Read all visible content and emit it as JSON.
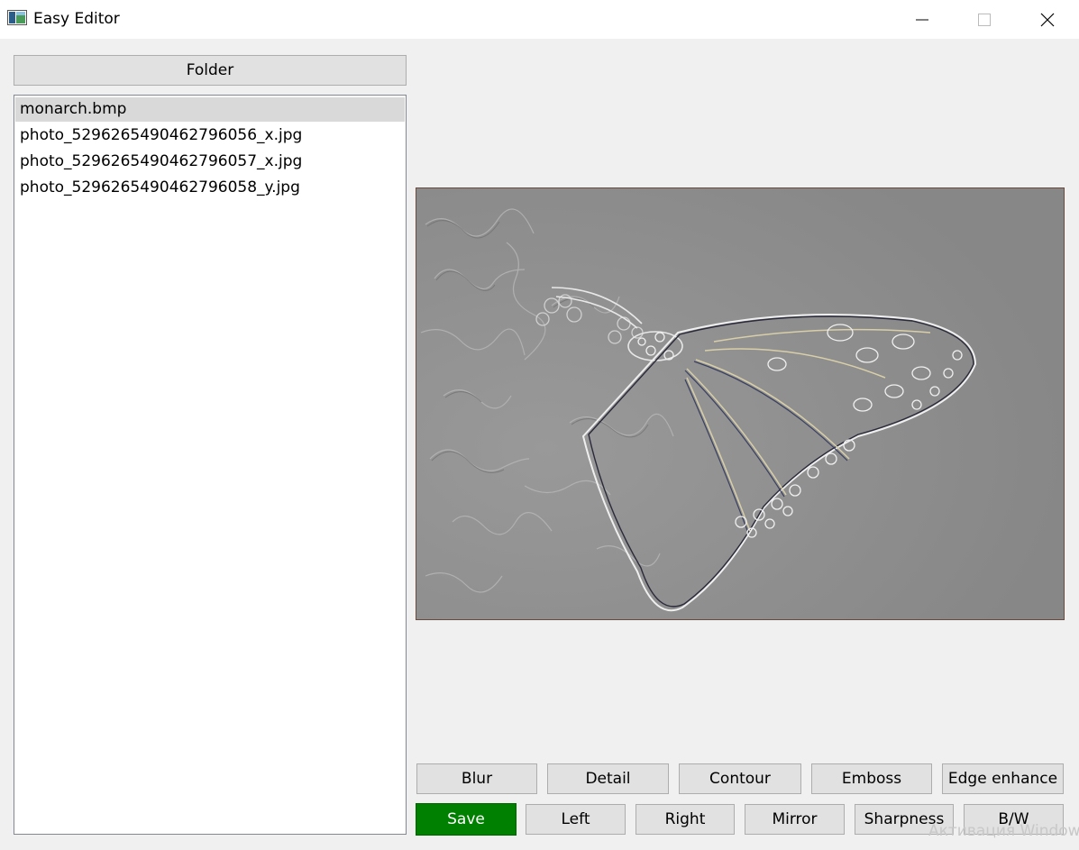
{
  "window": {
    "title": "Easy Editor",
    "icon": "app-window-icon",
    "controls": [
      "minimize-icon",
      "maximize-icon",
      "close-icon"
    ]
  },
  "sidebar": {
    "folder_button": "Folder",
    "files": [
      {
        "name": "monarch.bmp",
        "selected": true
      },
      {
        "name": "photo_5296265490462796056_x.jpg",
        "selected": false
      },
      {
        "name": "photo_5296265490462796057_x.jpg",
        "selected": false
      },
      {
        "name": "photo_5296265490462796058_y.jpg",
        "selected": false
      }
    ]
  },
  "image_view": {
    "subject": "embossed monarch butterfly photo",
    "filter_applied_visual": "emboss"
  },
  "toolbar": {
    "row1": {
      "blur": "Blur",
      "detail": "Detail",
      "contour": "Contour",
      "emboss": "Emboss",
      "edge_enhance": "Edge enhance"
    },
    "row2": {
      "save": "Save",
      "left": "Left",
      "right": "Right",
      "mirror": "Mirror",
      "sharpness": "Sharpness",
      "bw": "B/W"
    }
  },
  "colors": {
    "save_button": "#008000",
    "window_bg": "#f0f0f0",
    "button_bg": "#e1e1e1"
  },
  "watermark": "Активация Windows"
}
